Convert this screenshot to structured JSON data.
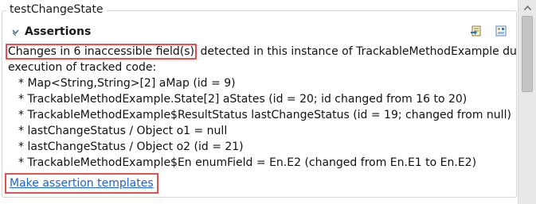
{
  "group": {
    "title": "testChangeState"
  },
  "section": {
    "title": "Assertions",
    "twisty_icon": "chevron-down-icon",
    "toolbar": [
      {
        "name": "export-icon"
      },
      {
        "name": "template-icon"
      }
    ]
  },
  "summary": {
    "highlighted": "Changes in 6 inaccessible field(s)",
    "rest_line1": " detected in this instance of TrackableMethodExample during",
    "line2": "execution of tracked code:"
  },
  "fields": [
    "* Map<String,String>[2] aMap (id = 9)",
    "* TrackableMethodExample.State[2] aStates (id = 20; id changed from 16 to 20)",
    "* TrackableMethodExample$ResultStatus lastChangeStatus (id = 19; changed from null)",
    "* lastChangeStatus / Object o1 = null",
    "* lastChangeStatus / Object o2 (id = 21)",
    "* TrackableMethodExample$En enumField = En.E2 (changed from En.E1 to En.E2)"
  ],
  "link": {
    "label": "Make assertion templates"
  },
  "colors": {
    "highlight_border": "#e2514f",
    "link": "#1f63c6"
  }
}
